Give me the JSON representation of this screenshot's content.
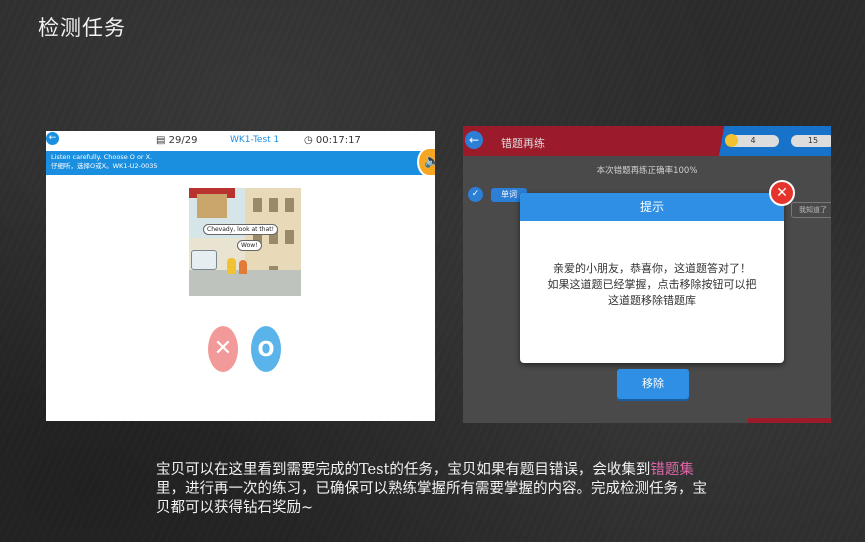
{
  "slide": {
    "title": "检测任务"
  },
  "left_screen": {
    "progress": "29/29",
    "test_name": "WK1-Test 1",
    "timer": "00:17:17",
    "instruction_en": "Listen carefully. Choose O or X.",
    "instruction_cn": "仔细听，选择O或X。WK1-U2-0035",
    "bubble_1": "Chevady, look at that!",
    "bubble_2": "Wow!",
    "icons": {
      "back": "back-arrow-icon",
      "speaker": "speaker-icon",
      "wrong": "x-icon",
      "right": "o-icon",
      "progress": "document-icon",
      "timer": "clock-icon"
    },
    "colors": {
      "accent": "#1a8fe0",
      "wrong": "#f29a9a",
      "right": "#5ab4ea"
    }
  },
  "right_screen": {
    "title": "错题再练",
    "coins": "4",
    "gems": "15",
    "rate_text": "本次错题再练正确率100%",
    "tag_label": "单词",
    "know_button": "我知道了",
    "dialog": {
      "title": "提示",
      "line1": "亲爱的小朋友，恭喜你，这道题答对了！",
      "line2": "如果这道题已经掌握，点击移除按钮可以把",
      "line3": "这道题移除错题库",
      "remove_button": "移除"
    },
    "colors": {
      "header": "#9c1b2b",
      "accent": "#2e8fe4",
      "close": "#e5342b"
    }
  },
  "caption": {
    "part1": "宝贝可以在这里看到需要完成的Test的任务，宝贝如果有题目错误，会收集到",
    "highlight": "错题集",
    "part2": "里，进行再一次的练习，已确保可以熟练掌握所有需要掌握的内容。完成检测任务，宝贝都可以获得钻石奖励~",
    "highlight_color": "#e067a8"
  }
}
